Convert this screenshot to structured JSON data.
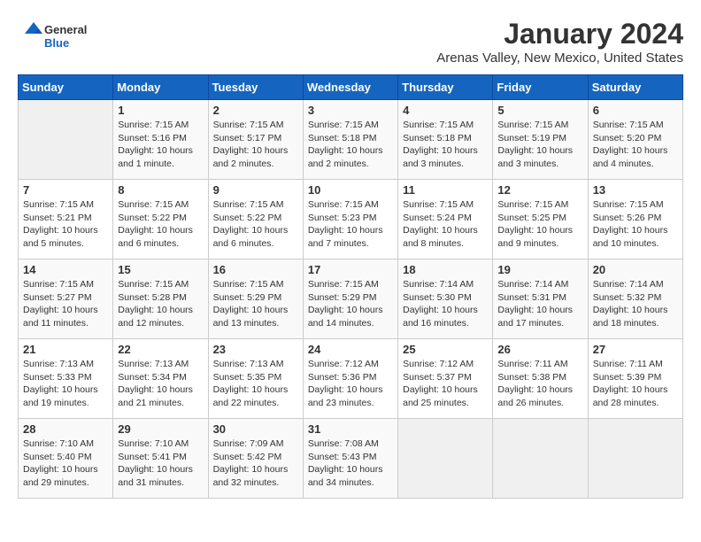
{
  "header": {
    "logo_general": "General",
    "logo_blue": "Blue",
    "title": "January 2024",
    "subtitle": "Arenas Valley, New Mexico, United States"
  },
  "calendar": {
    "columns": [
      "Sunday",
      "Monday",
      "Tuesday",
      "Wednesday",
      "Thursday",
      "Friday",
      "Saturday"
    ],
    "weeks": [
      [
        {
          "day": "",
          "info": ""
        },
        {
          "day": "1",
          "info": "Sunrise: 7:15 AM\nSunset: 5:16 PM\nDaylight: 10 hours\nand 1 minute."
        },
        {
          "day": "2",
          "info": "Sunrise: 7:15 AM\nSunset: 5:17 PM\nDaylight: 10 hours\nand 2 minutes."
        },
        {
          "day": "3",
          "info": "Sunrise: 7:15 AM\nSunset: 5:18 PM\nDaylight: 10 hours\nand 2 minutes."
        },
        {
          "day": "4",
          "info": "Sunrise: 7:15 AM\nSunset: 5:18 PM\nDaylight: 10 hours\nand 3 minutes."
        },
        {
          "day": "5",
          "info": "Sunrise: 7:15 AM\nSunset: 5:19 PM\nDaylight: 10 hours\nand 3 minutes."
        },
        {
          "day": "6",
          "info": "Sunrise: 7:15 AM\nSunset: 5:20 PM\nDaylight: 10 hours\nand 4 minutes."
        }
      ],
      [
        {
          "day": "7",
          "info": "Sunrise: 7:15 AM\nSunset: 5:21 PM\nDaylight: 10 hours\nand 5 minutes."
        },
        {
          "day": "8",
          "info": "Sunrise: 7:15 AM\nSunset: 5:22 PM\nDaylight: 10 hours\nand 6 minutes."
        },
        {
          "day": "9",
          "info": "Sunrise: 7:15 AM\nSunset: 5:22 PM\nDaylight: 10 hours\nand 6 minutes."
        },
        {
          "day": "10",
          "info": "Sunrise: 7:15 AM\nSunset: 5:23 PM\nDaylight: 10 hours\nand 7 minutes."
        },
        {
          "day": "11",
          "info": "Sunrise: 7:15 AM\nSunset: 5:24 PM\nDaylight: 10 hours\nand 8 minutes."
        },
        {
          "day": "12",
          "info": "Sunrise: 7:15 AM\nSunset: 5:25 PM\nDaylight: 10 hours\nand 9 minutes."
        },
        {
          "day": "13",
          "info": "Sunrise: 7:15 AM\nSunset: 5:26 PM\nDaylight: 10 hours\nand 10 minutes."
        }
      ],
      [
        {
          "day": "14",
          "info": "Sunrise: 7:15 AM\nSunset: 5:27 PM\nDaylight: 10 hours\nand 11 minutes."
        },
        {
          "day": "15",
          "info": "Sunrise: 7:15 AM\nSunset: 5:28 PM\nDaylight: 10 hours\nand 12 minutes."
        },
        {
          "day": "16",
          "info": "Sunrise: 7:15 AM\nSunset: 5:29 PM\nDaylight: 10 hours\nand 13 minutes."
        },
        {
          "day": "17",
          "info": "Sunrise: 7:15 AM\nSunset: 5:29 PM\nDaylight: 10 hours\nand 14 minutes."
        },
        {
          "day": "18",
          "info": "Sunrise: 7:14 AM\nSunset: 5:30 PM\nDaylight: 10 hours\nand 16 minutes."
        },
        {
          "day": "19",
          "info": "Sunrise: 7:14 AM\nSunset: 5:31 PM\nDaylight: 10 hours\nand 17 minutes."
        },
        {
          "day": "20",
          "info": "Sunrise: 7:14 AM\nSunset: 5:32 PM\nDaylight: 10 hours\nand 18 minutes."
        }
      ],
      [
        {
          "day": "21",
          "info": "Sunrise: 7:13 AM\nSunset: 5:33 PM\nDaylight: 10 hours\nand 19 minutes."
        },
        {
          "day": "22",
          "info": "Sunrise: 7:13 AM\nSunset: 5:34 PM\nDaylight: 10 hours\nand 21 minutes."
        },
        {
          "day": "23",
          "info": "Sunrise: 7:13 AM\nSunset: 5:35 PM\nDaylight: 10 hours\nand 22 minutes."
        },
        {
          "day": "24",
          "info": "Sunrise: 7:12 AM\nSunset: 5:36 PM\nDaylight: 10 hours\nand 23 minutes."
        },
        {
          "day": "25",
          "info": "Sunrise: 7:12 AM\nSunset: 5:37 PM\nDaylight: 10 hours\nand 25 minutes."
        },
        {
          "day": "26",
          "info": "Sunrise: 7:11 AM\nSunset: 5:38 PM\nDaylight: 10 hours\nand 26 minutes."
        },
        {
          "day": "27",
          "info": "Sunrise: 7:11 AM\nSunset: 5:39 PM\nDaylight: 10 hours\nand 28 minutes."
        }
      ],
      [
        {
          "day": "28",
          "info": "Sunrise: 7:10 AM\nSunset: 5:40 PM\nDaylight: 10 hours\nand 29 minutes."
        },
        {
          "day": "29",
          "info": "Sunrise: 7:10 AM\nSunset: 5:41 PM\nDaylight: 10 hours\nand 31 minutes."
        },
        {
          "day": "30",
          "info": "Sunrise: 7:09 AM\nSunset: 5:42 PM\nDaylight: 10 hours\nand 32 minutes."
        },
        {
          "day": "31",
          "info": "Sunrise: 7:08 AM\nSunset: 5:43 PM\nDaylight: 10 hours\nand 34 minutes."
        },
        {
          "day": "",
          "info": ""
        },
        {
          "day": "",
          "info": ""
        },
        {
          "day": "",
          "info": ""
        }
      ]
    ]
  }
}
